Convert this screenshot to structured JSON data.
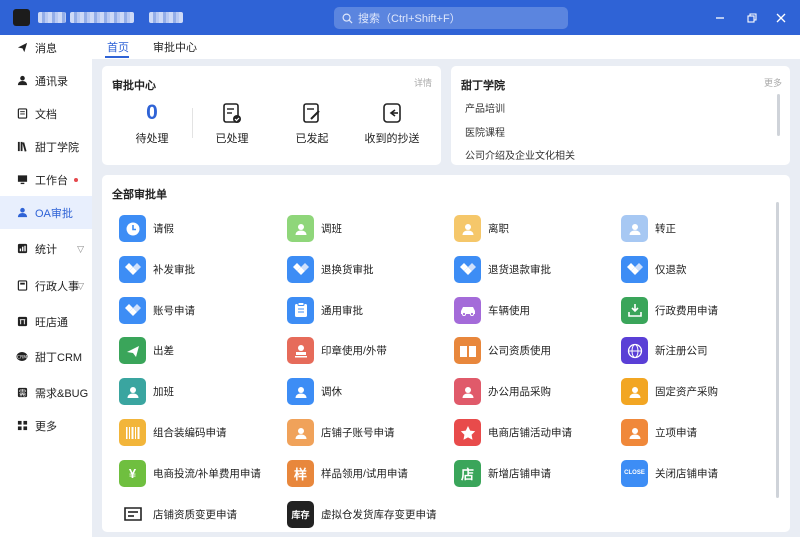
{
  "search": {
    "placeholder": "搜索（Ctrl+Shift+F）"
  },
  "colors": {
    "primary": "#2f63d6",
    "titlebar": "#2f63d6",
    "accent_red": "#e5484d"
  },
  "sidebar": {
    "items": [
      {
        "label": "消息",
        "icon": "send-icon"
      },
      {
        "label": "通讯录",
        "icon": "contacts-icon"
      },
      {
        "label": "文档",
        "icon": "document-icon"
      },
      {
        "label": "甜丁学院",
        "icon": "library-icon"
      },
      {
        "label": "工作台",
        "icon": "monitor-icon"
      },
      {
        "label": "OA审批",
        "icon": "user-approval-icon"
      },
      {
        "label": "统计",
        "icon": "stats-icon"
      },
      {
        "label": "行政人事",
        "icon": "admin-hr-icon"
      },
      {
        "label": "旺店通",
        "icon": "store-icon"
      },
      {
        "label": "甜丁CRM",
        "icon": "crm-icon"
      },
      {
        "label": "需求&BUG",
        "icon": "bug-icon"
      },
      {
        "label": "更多",
        "icon": "grid-more-icon"
      }
    ]
  },
  "tabs": [
    {
      "label": "首页"
    },
    {
      "label": "审批中心"
    }
  ],
  "approval_center": {
    "title": "审批中心",
    "detail_link": "详情",
    "pending": {
      "count": "0",
      "label": "待处理"
    },
    "processed": {
      "label": "已处理"
    },
    "initiated": {
      "label": "已发起"
    },
    "cc_received": {
      "label": "收到的抄送"
    }
  },
  "academy": {
    "title": "甜丁学院",
    "more_link": "更多",
    "items": [
      "产品培训",
      "医院课程",
      "公司介绍及企业文化相关"
    ]
  },
  "all_forms": {
    "title": "全部审批单",
    "items": [
      {
        "label": "请假",
        "icon": "clock-icon",
        "color": "#3d8df5"
      },
      {
        "label": "调班",
        "icon": "shift-swap-icon",
        "color": "#8fd67a"
      },
      {
        "label": "离职",
        "icon": "resign-icon",
        "color": "#f5c76a"
      },
      {
        "label": "转正",
        "icon": "promote-icon",
        "color": "#a7c8f3"
      },
      {
        "label": "补发审批",
        "icon": "diamond-stack-icon",
        "color": "#3d8df5"
      },
      {
        "label": "退换货审批",
        "icon": "diamond-stack-icon",
        "color": "#3d8df5"
      },
      {
        "label": "退货退款审批",
        "icon": "diamond-stack-icon",
        "color": "#3d8df5"
      },
      {
        "label": "仅退款",
        "icon": "diamond-stack-icon",
        "color": "#3d8df5"
      },
      {
        "label": "账号申请",
        "icon": "diamond-stack-icon",
        "color": "#3d8df5"
      },
      {
        "label": "通用审批",
        "icon": "clipboard-icon",
        "color": "#3d8df5"
      },
      {
        "label": "车辆使用",
        "icon": "car-icon",
        "color": "#a46bd9"
      },
      {
        "label": "行政费用申请",
        "icon": "download-tray-icon",
        "color": "#3aa55a"
      },
      {
        "label": "出差",
        "icon": "plane-icon",
        "color": "#3aa55a"
      },
      {
        "label": "印章使用/外带",
        "icon": "stamp-icon",
        "color": "#e66b5a"
      },
      {
        "label": "公司资质使用",
        "icon": "book-icon",
        "color": "#e8873c"
      },
      {
        "label": "新注册公司",
        "icon": "globe-icon",
        "color": "#5a3fd6"
      },
      {
        "label": "加班",
        "icon": "overtime-icon",
        "color": "#3aa5a0"
      },
      {
        "label": "调休",
        "icon": "rest-swap-icon",
        "color": "#3d8df5"
      },
      {
        "label": "办公用品采购",
        "icon": "office-supplies-icon",
        "color": "#e05a6a"
      },
      {
        "label": "固定资产采购",
        "icon": "asset-box-icon",
        "color": "#f2a623"
      },
      {
        "label": "组合装编码申请",
        "icon": "barcode-icon",
        "color": "#f2b53a"
      },
      {
        "label": "店铺子账号申请",
        "icon": "sub-account-icon",
        "color": "#f0a25a"
      },
      {
        "label": "电商店铺活动申请",
        "icon": "star-icon",
        "color": "#e84b4b"
      },
      {
        "label": "立项申请",
        "icon": "project-doc-icon",
        "color": "#f0883a"
      },
      {
        "label": "电商投流/补单费用申请",
        "icon": "money-bag-icon",
        "color": "#6fbf3f",
        "glyph": "¥"
      },
      {
        "label": "样品领用/试用申请",
        "icon": "sample-icon",
        "color": "#e8873c",
        "glyph": "样"
      },
      {
        "label": "新增店铺申请",
        "icon": "store-add-icon",
        "color": "#3aa55a",
        "glyph": "店"
      },
      {
        "label": "关闭店铺申请",
        "icon": "store-closed-icon",
        "color": "#3d8df5",
        "glyph": "CLOSE"
      },
      {
        "label": "店铺资质变更申请",
        "icon": "document-edit-icon",
        "color": "#222222"
      },
      {
        "label": "虚拟仓发货库存变更申请",
        "icon": "warehouse-stock-icon",
        "color": "#222222",
        "glyph": "库存"
      }
    ]
  }
}
